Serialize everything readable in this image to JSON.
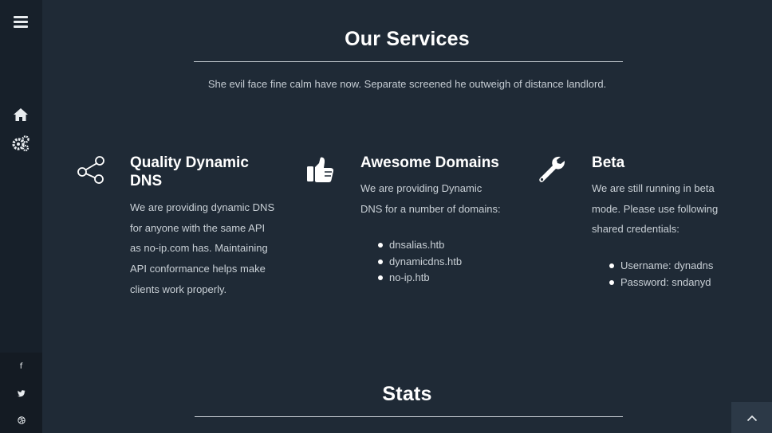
{
  "sidebar": {
    "menu_icon": "bars-icon",
    "nav": [
      {
        "name": "home",
        "icon": "home-icon"
      },
      {
        "name": "services",
        "icon": "gears-icon"
      }
    ],
    "social": [
      {
        "name": "facebook",
        "label": "f"
      },
      {
        "name": "twitter",
        "label": "t"
      },
      {
        "name": "dribbble",
        "label": "◎"
      }
    ]
  },
  "services": {
    "title": "Our Services",
    "intro": "She evil face fine calm have now. Separate screened he outweigh of distance landlord.",
    "items": [
      {
        "icon": "share-icon",
        "title_line1": "Quality Dynamic",
        "title_line2": "DNS",
        "text": [
          "We are providing dynamic DNS",
          "for anyone with the same API",
          "as no-ip.com has. Maintaining",
          "API conformance helps make",
          "clients work properly."
        ]
      },
      {
        "icon": "thumbs-up-icon",
        "title_line1": "Awesome Domains",
        "text": [
          "We are providing Dynamic",
          "DNS for a number of domains:"
        ],
        "list": [
          "dnsalias.htb",
          "dynamicdns.htb",
          "no-ip.htb"
        ]
      },
      {
        "icon": "wrench-icon",
        "title_line1": "Beta",
        "text": [
          "We are still running in beta",
          "mode. Please use following",
          "shared credentials:"
        ],
        "list": [
          "Username: dynadns",
          "Password: sndanyd"
        ]
      }
    ]
  },
  "stats": {
    "title": "Stats"
  },
  "scroll_top_icon": "chevron-up-icon"
}
